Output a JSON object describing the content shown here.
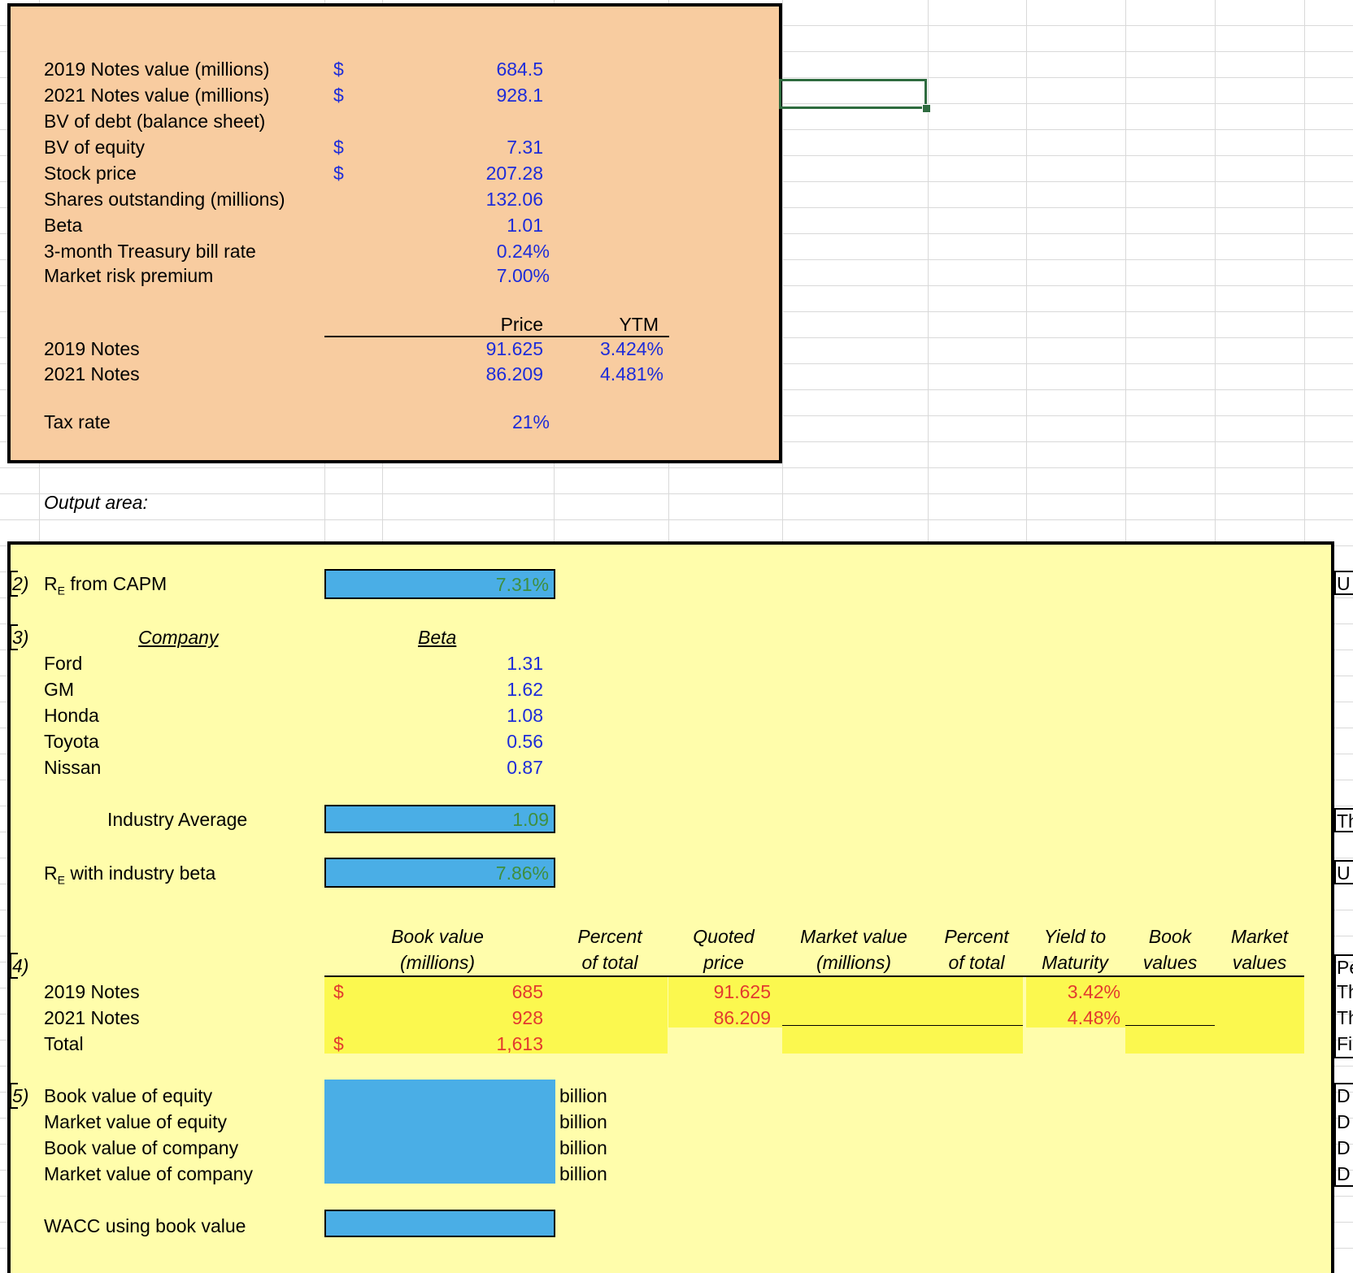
{
  "inputs": {
    "rows": [
      {
        "label": "2019 Notes value (millions)",
        "currency": "$",
        "value": "684.5"
      },
      {
        "label": "2021 Notes value (millions)",
        "currency": "$",
        "value": "928.1"
      },
      {
        "label": "BV of debt (balance sheet)",
        "currency": "",
        "value": ""
      },
      {
        "label": "BV of equity",
        "currency": "$",
        "value": "7.31"
      },
      {
        "label": "Stock price",
        "currency": "$",
        "value": "207.28"
      },
      {
        "label": "Shares outstanding (millions)",
        "currency": "",
        "value": "132.06"
      },
      {
        "label": "Beta",
        "currency": "",
        "value": "1.01"
      },
      {
        "label": "3-month Treasury bill rate",
        "currency": "",
        "value": "0.24%"
      },
      {
        "label": "Market risk premium",
        "currency": "",
        "value": "7.00%"
      }
    ],
    "notes_header": {
      "price": "Price",
      "ytm": "YTM"
    },
    "notes": [
      {
        "label": "2019 Notes",
        "price": "91.625",
        "ytm": "3.424%"
      },
      {
        "label": "2021 Notes",
        "price": "86.209",
        "ytm": "4.481%"
      }
    ],
    "tax_rate": {
      "label": "Tax rate",
      "value": "21%"
    }
  },
  "output_label": "Output area:",
  "q2": {
    "num": "2)",
    "label_pre": "R",
    "label_sub": "E",
    "label_post": " from CAPM",
    "value": "7.31%"
  },
  "q3": {
    "num": "3)",
    "company_header": "Company",
    "beta_header": "Beta",
    "companies": [
      {
        "name": "Ford",
        "beta": "1.31"
      },
      {
        "name": "GM",
        "beta": "1.62"
      },
      {
        "name": "Honda",
        "beta": "1.08"
      },
      {
        "name": "Toyota",
        "beta": "0.56"
      },
      {
        "name": "Nissan",
        "beta": "0.87"
      }
    ],
    "industry_avg_label": "Industry Average",
    "industry_avg_value": "1.09",
    "re_industry_pre": "R",
    "re_industry_sub": "E",
    "re_industry_post": " with industry beta",
    "re_industry_value": "7.86%"
  },
  "q4": {
    "num": "4)",
    "headers": [
      {
        "l1": "Book value",
        "l2": "(millions)"
      },
      {
        "l1": "Percent",
        "l2": "of total"
      },
      {
        "l1": "Quoted",
        "l2": "price"
      },
      {
        "l1": "Market value",
        "l2": "(millions)"
      },
      {
        "l1": "Percent",
        "l2": "of total"
      },
      {
        "l1": "Yield to",
        "l2": "Maturity"
      },
      {
        "l1": "Book",
        "l2": "values"
      },
      {
        "l1": "Market",
        "l2": "values"
      }
    ],
    "rows": [
      {
        "label": "2019 Notes",
        "currency": "$",
        "book": "685",
        "price": "91.625",
        "ytm": "3.42%"
      },
      {
        "label": "2021 Notes",
        "currency": "",
        "book": "928",
        "price": "86.209",
        "ytm": "4.48%"
      },
      {
        "label": "Total",
        "currency": "$",
        "book": "1,613",
        "price": "",
        "ytm": ""
      }
    ]
  },
  "q5": {
    "num": "5)",
    "rows": [
      {
        "label": "Book value of equity",
        "unit": "billion"
      },
      {
        "label": "Market value of equity",
        "unit": "billion"
      },
      {
        "label": "Book value of company",
        "unit": "billion"
      },
      {
        "label": "Market value of company",
        "unit": "billion"
      }
    ],
    "wacc_label": "WACC using book value"
  },
  "right_edge": [
    "U",
    "Th",
    "U",
    "Pe",
    "Th",
    "Th",
    "Fi",
    "D",
    "D",
    "D",
    "D"
  ],
  "colors": {
    "input_fill": "#f8cca0",
    "output_fill": "#fffdab",
    "answer_cell": "#4aaee6",
    "highlight": "#fbf84f",
    "input_text": "#1d2cd9",
    "computed_text": "#e23a2e",
    "answer_text": "#3f8f3f",
    "selection": "#2e6b3f"
  }
}
